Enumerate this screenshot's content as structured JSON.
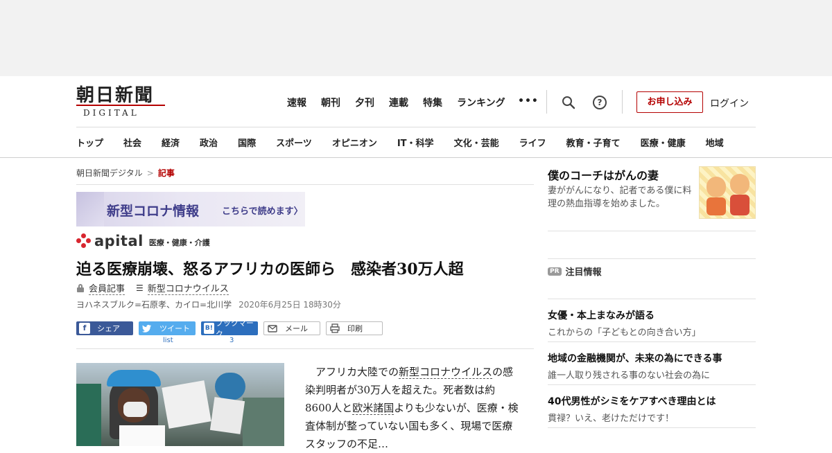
{
  "header": {
    "logo_jp": "朝日新聞",
    "logo_en": "DIGITAL",
    "topnav": [
      "速報",
      "朝刊",
      "夕刊",
      "連載",
      "特集",
      "ランキング"
    ],
    "more": "•••",
    "apply": "お申し込み",
    "login": "ログイン",
    "help": "?"
  },
  "categories": [
    "トップ",
    "社会",
    "経済",
    "政治",
    "国際",
    "スポーツ",
    "オピニオン",
    "IT・科学",
    "文化・芸能",
    "ライフ",
    "教育・子育て",
    "医療・健康",
    "地域"
  ],
  "breadcrumb": {
    "home": "朝日新聞デジタル",
    "sep": ">",
    "current": "記事"
  },
  "banner": {
    "title": "新型コロナ情報",
    "link": "こちらで読めます〉"
  },
  "apital": {
    "word": "apital",
    "sub": "医療・健康・介護"
  },
  "article": {
    "headline": "迫る医療崩壊、怒るアフリカの医師ら　感染者30万人超",
    "member": "会員記事",
    "topic": "新型コロナウイルス",
    "byline": "ヨハネスブルク=石原孝、カイロ=北川学",
    "date": "2020年6月25日 18時30分",
    "body_1": "　アフリカ大陸での",
    "body_link1": "新型コロナウイルス",
    "body_2": "の感染判明者が30万人を超えた。死者数は約8600人と",
    "body_link2": "欧米諸国",
    "body_3": "よりも少ないが、医療・検査体制が整っていない国も多く、現場で医療スタッフの不足…"
  },
  "share": {
    "facebook": "シェア",
    "twitter": "ツイート",
    "twitter_count": "list",
    "hatena": "ブックマーク",
    "hatena_count": "3",
    "mail": "メール",
    "print": "印刷"
  },
  "sidebar": {
    "feature_title": "僕のコーチはがんの妻",
    "feature_desc": "妻ががんになり、記者である僕に料理の熱血指導を始めました。",
    "pr_badge": "PR",
    "pr_title": "注目情報",
    "promos": [
      {
        "title": "女優・本上まなみが語る",
        "sub": "これからの「子どもとの向き合い方」"
      },
      {
        "title": "地域の金融機関が、未来の為にできる事",
        "sub": "誰一人取り残される事のない社会の為に"
      },
      {
        "title": "40代男性がシミをケアすべき理由とは",
        "sub": "貫禄？いえ、老けただけです！"
      }
    ]
  },
  "colors": {
    "brand_red": "#b40000",
    "facebook": "#3b5998",
    "twitter": "#55acee",
    "hatena": "#2c6ebd",
    "covid_banner": "#3f3d8a"
  }
}
